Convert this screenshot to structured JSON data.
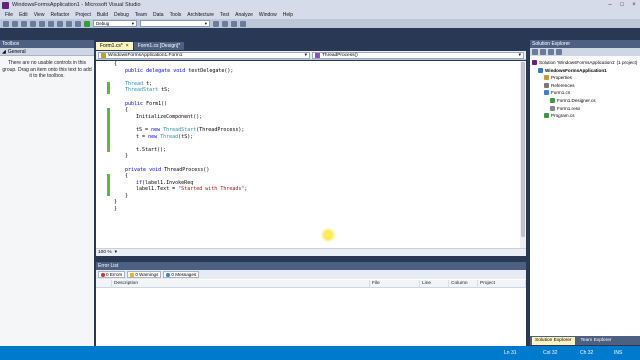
{
  "window": {
    "title": "WindowsFormsApplication1 - Microsoft Visual Studio",
    "controls": {
      "minimize": "–",
      "maximize": "□",
      "close": "×"
    }
  },
  "menu": [
    "File",
    "Edit",
    "View",
    "Refactor",
    "Project",
    "Build",
    "Debug",
    "Team",
    "Data",
    "Tools",
    "Architecture",
    "Test",
    "Analyze",
    "Window",
    "Help"
  ],
  "toolbar": {
    "config_combo": "Debug"
  },
  "toolbox": {
    "title": "Toolbox",
    "group": "General",
    "message": "There are no usable controls in this group. Drag an item onto this text to add it to the toolbox."
  },
  "editor": {
    "tabs": [
      {
        "label": "Form1.cs*",
        "active": true
      },
      {
        "label": "Form1.cs [Design]*",
        "active": false
      }
    ],
    "nav_left": "WindowsFormsApplication1.Form1",
    "nav_right": "ThreadProcess()",
    "zoom": "100 %",
    "code_lines": [
      {
        "t": "{",
        "indent": 0
      },
      {
        "t": "public delegate void testDelegate();",
        "indent": 1
      },
      {
        "t": "",
        "indent": 0
      },
      {
        "t": "Thread t;",
        "indent": 1
      },
      {
        "t": "ThreadStart tS;",
        "indent": 1
      },
      {
        "t": "",
        "indent": 0
      },
      {
        "t": "public Form1()",
        "indent": 1
      },
      {
        "t": "{",
        "indent": 1
      },
      {
        "t": "InitializeComponent();",
        "indent": 2
      },
      {
        "t": "",
        "indent": 0
      },
      {
        "t": "tS = new ThreadStart(ThreadProcess);",
        "indent": 2
      },
      {
        "t": "t = new Thread(tS);",
        "indent": 2
      },
      {
        "t": "",
        "indent": 0
      },
      {
        "t": "t.Start();",
        "indent": 2
      },
      {
        "t": "}",
        "indent": 1
      },
      {
        "t": "",
        "indent": 0
      },
      {
        "t": "private void ThreadProcess()",
        "indent": 1
      },
      {
        "t": "{",
        "indent": 1
      },
      {
        "t": "if(label1.InvokeReq",
        "indent": 2
      },
      {
        "t": "label1.Text = \"Started with Threads\";",
        "indent": 2
      },
      {
        "t": "}",
        "indent": 1
      },
      {
        "t": "}",
        "indent": 0
      },
      {
        "t": "}",
        "indent": 0
      }
    ]
  },
  "error_list": {
    "title": "Error List",
    "errors": "0 Errors",
    "warnings": "0 Warnings",
    "messages": "0 Messages",
    "columns": [
      "Description",
      "File",
      "Line",
      "Column",
      "Project"
    ]
  },
  "solution_explorer": {
    "title": "Solution Explorer",
    "items": [
      {
        "label": "Solution 'WindowsFormsApplication1' (1 project)",
        "level": 0,
        "icon": "solution-icon",
        "color": "#68217a"
      },
      {
        "label": "WindowsFormsApplication1",
        "level": 1,
        "icon": "project-icon",
        "color": "#2e7bcf"
      },
      {
        "label": "Properties",
        "level": 2,
        "icon": "properties-icon",
        "color": "#c49a3a"
      },
      {
        "label": "References",
        "level": 2,
        "icon": "references-icon",
        "color": "#7a7a7a"
      },
      {
        "label": "Form1.cs",
        "level": 2,
        "icon": "form-icon",
        "color": "#3b7fd0"
      },
      {
        "label": "Form1.Designer.cs",
        "level": 3,
        "icon": "cs-file-icon",
        "color": "#3c9b3c"
      },
      {
        "label": "Form1.resx",
        "level": 3,
        "icon": "resx-icon",
        "color": "#888888"
      },
      {
        "label": "Program.cs",
        "level": 2,
        "icon": "cs-file-icon",
        "color": "#3c9b3c"
      }
    ],
    "tabs": [
      "Solution Explorer",
      "Team Explorer"
    ]
  },
  "status": {
    "ln": "Ln 31",
    "col": "Col 32",
    "ch": "Ch 32",
    "mode": "INS"
  },
  "colors": {
    "accent": "#007acc",
    "chrome": "#293955",
    "panel_header": "#4d6082",
    "active_tab": "#fdf4bf"
  }
}
